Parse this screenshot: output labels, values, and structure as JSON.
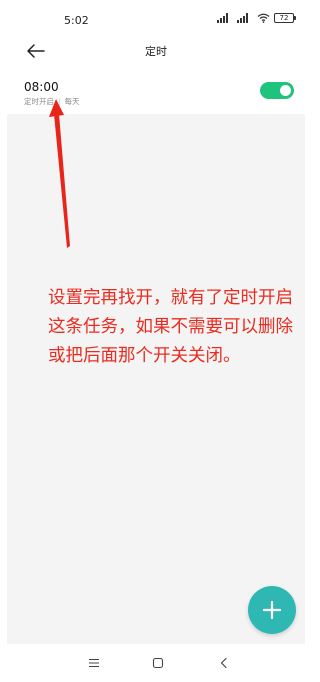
{
  "status_bar": {
    "time": "5:02",
    "battery": "72"
  },
  "app_bar": {
    "title": "定时"
  },
  "timer": {
    "time": "08:00",
    "status": "定时开启",
    "repeat": "每天",
    "enabled": true
  },
  "annotation": {
    "text": "设置完再找开，就有了定时开启这条任务，如果不需要可以删除或把后面那个开关关闭。"
  },
  "colors": {
    "toggle_on": "#1fc37c",
    "fab": "#2fb7b4",
    "annotation": "#ea2b1f"
  }
}
